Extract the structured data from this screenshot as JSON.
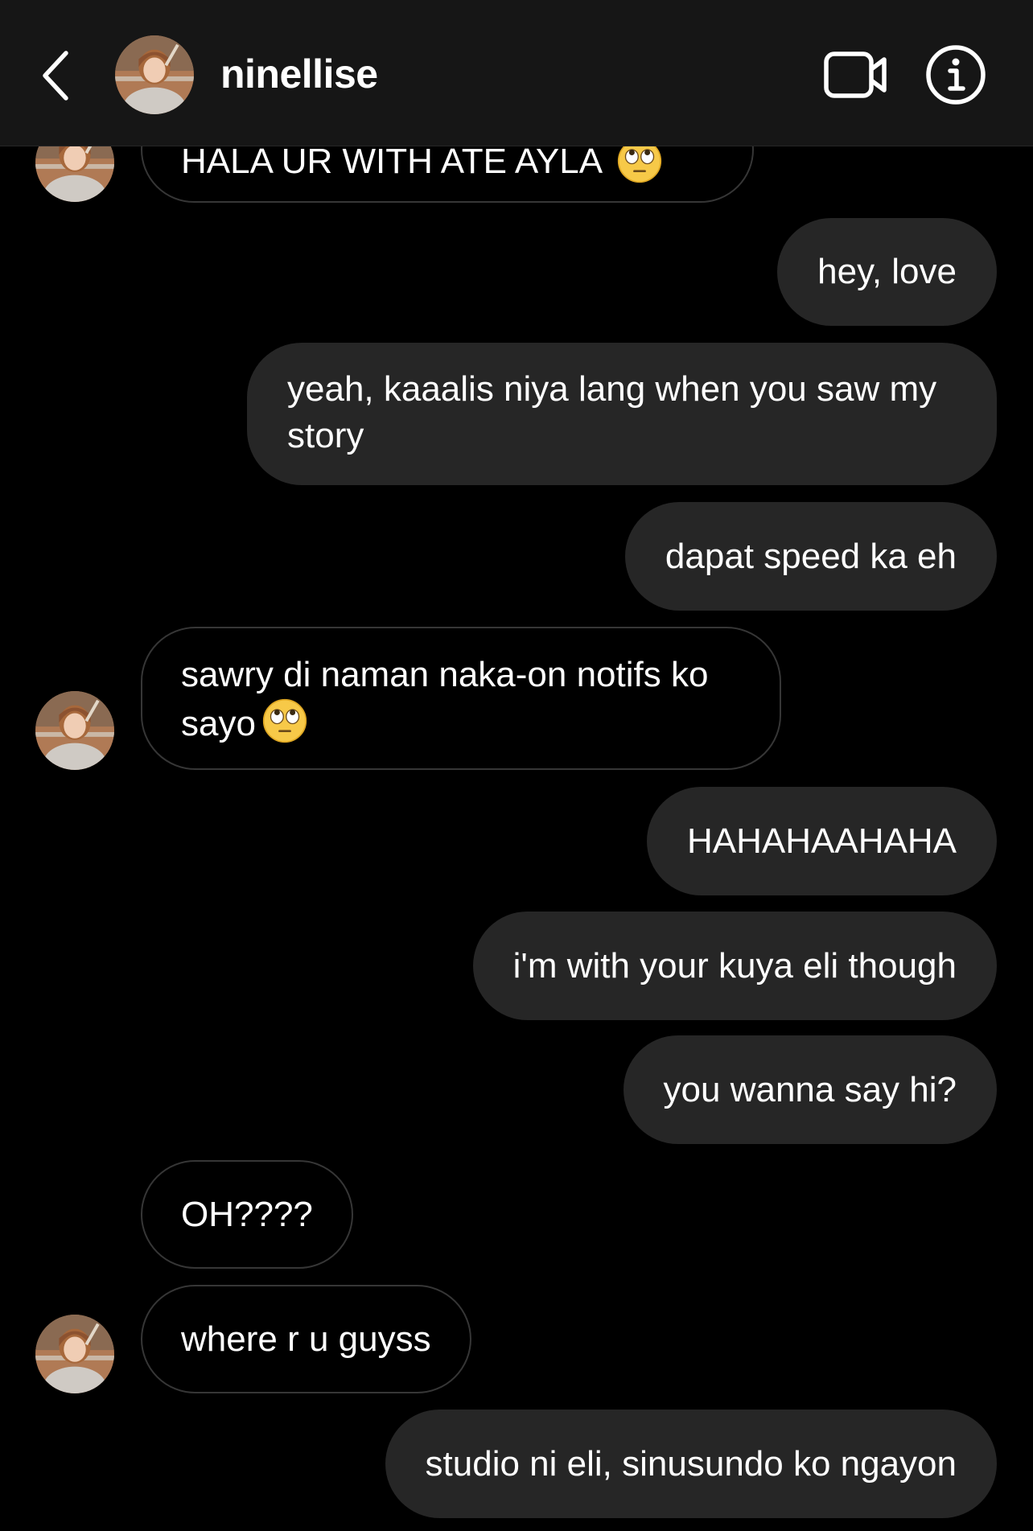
{
  "header": {
    "username": "ninellise"
  },
  "messages": [
    {
      "side": "in",
      "text": "HALA UR WITH ATE AYLA",
      "emoji": "face-with-rolling-eyes"
    },
    {
      "side": "out",
      "text": "hey, love"
    },
    {
      "side": "out",
      "text": "yeah, kaaalis niya lang when you saw my story"
    },
    {
      "side": "out",
      "text": "dapat speed ka eh"
    },
    {
      "side": "in",
      "text": "sawry di naman naka-on notifs ko sayo",
      "emoji": "face-with-rolling-eyes"
    },
    {
      "side": "out",
      "text": "HAHAHAAHAHA"
    },
    {
      "side": "out",
      "text": "i'm with your kuya eli though"
    },
    {
      "side": "out",
      "text": "you wanna say hi?"
    },
    {
      "side": "in",
      "text": "OH????"
    },
    {
      "side": "in",
      "text": "where r u guyss"
    },
    {
      "side": "out",
      "text": "studio ni eli, sinusundo ko ngayon"
    }
  ],
  "icons": {
    "back": "chevron-left-icon",
    "video": "video-camera-icon",
    "info": "info-icon"
  },
  "colors": {
    "background": "#000000",
    "header": "#161616",
    "outgoing_bubble": "#262626",
    "incoming_border": "#363636",
    "text": "#ffffff"
  }
}
